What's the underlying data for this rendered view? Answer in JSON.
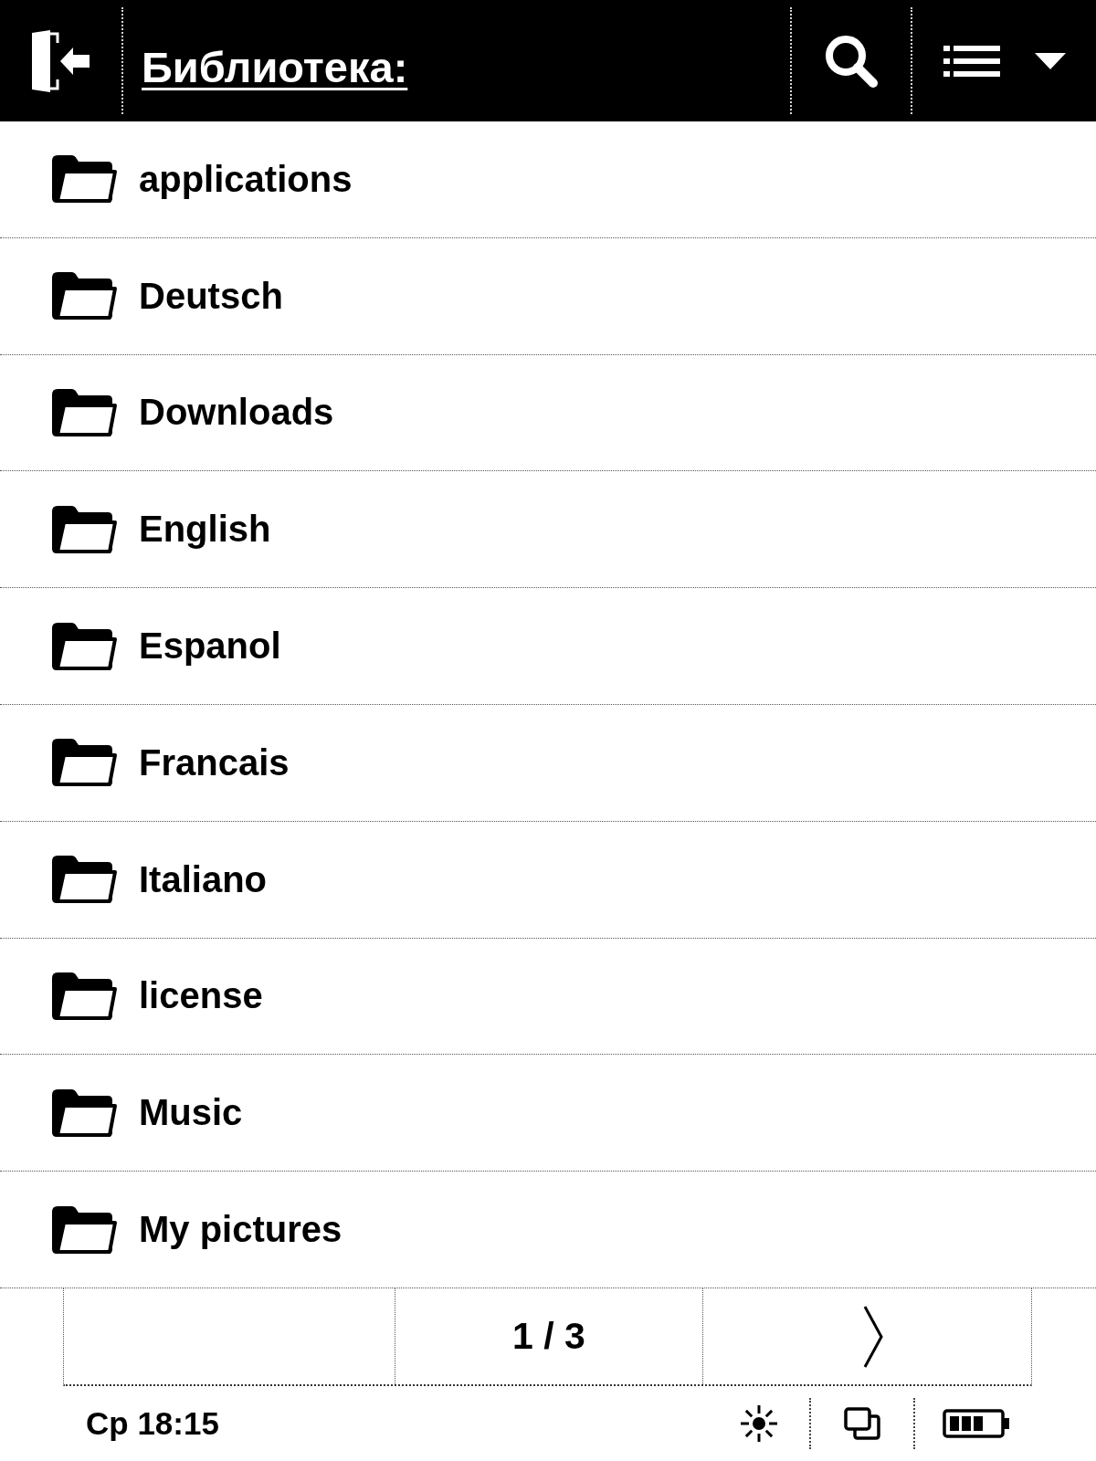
{
  "header": {
    "title": "Библиотека:"
  },
  "folders": [
    {
      "name": "applications"
    },
    {
      "name": "Deutsch"
    },
    {
      "name": "Downloads"
    },
    {
      "name": "English"
    },
    {
      "name": "Espanol"
    },
    {
      "name": "Francais"
    },
    {
      "name": "Italiano"
    },
    {
      "name": "license"
    },
    {
      "name": "Music"
    },
    {
      "name": "My pictures"
    }
  ],
  "pager": {
    "page": "1 / 3"
  },
  "status_bar": {
    "time": "Ср 18:15"
  }
}
